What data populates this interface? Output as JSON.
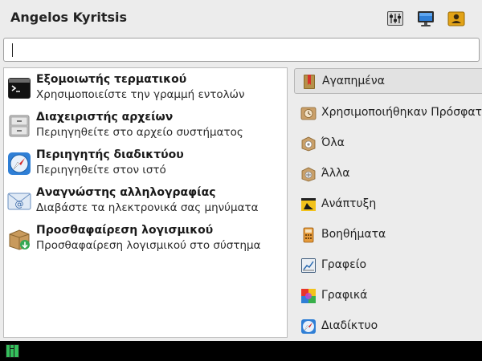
{
  "header": {
    "user_name": "Angelos Kyritsis",
    "icons": [
      "settings-mixer-icon",
      "display-monitor-icon",
      "user-lock-icon"
    ]
  },
  "search": {
    "value": "",
    "placeholder": ""
  },
  "apps": [
    {
      "title": "Εξομοιωτής τερματικού",
      "desc": "Χρησιμοποιείστε την γραμμή εντολών",
      "icon": "terminal-icon"
    },
    {
      "title": "Διαχειριστής αρχείων",
      "desc": "Περιηγηθείτε στο αρχείο συστήματος",
      "icon": "file-cabinet-icon"
    },
    {
      "title": "Περιηγητής διαδικτύου",
      "desc": "Περιηγηθείτε στον ιστό",
      "icon": "compass-icon"
    },
    {
      "title": "Αναγνώστης αλληλογραφίας",
      "desc": "Διαβάστε τα ηλεκτρονικά σας μηνύματα",
      "icon": "mail-icon"
    },
    {
      "title": "Προσθαφαίρεση λογισμικού",
      "desc": "Προσθαφαίρεση λογισμικού στο σύστημα",
      "icon": "package-install-icon"
    }
  ],
  "categories": [
    {
      "label": "Αγαπημένα",
      "icon": "bookmark-icon",
      "selected": true
    },
    {
      "label": "Χρησιμοποιήθηκαν Πρόσφατα",
      "icon": "recent-clock-icon"
    },
    {
      "label": "Όλα",
      "icon": "all-apps-icon"
    },
    {
      "label": "Άλλα",
      "icon": "other-apps-icon"
    },
    {
      "label": "Ανάπτυξη",
      "icon": "development-icon"
    },
    {
      "label": "Βοηθήματα",
      "icon": "accessories-icon"
    },
    {
      "label": "Γραφείο",
      "icon": "office-chart-icon"
    },
    {
      "label": "Γραφικά",
      "icon": "graphics-palette-icon"
    },
    {
      "label": "Διαδίκτυο",
      "icon": "internet-icon"
    }
  ],
  "taskbar": {
    "icon": "manjaro-logo-icon"
  },
  "colors": {
    "accent": "#35bf5c",
    "taskbar": "#000000",
    "panel": "#ffffff"
  }
}
